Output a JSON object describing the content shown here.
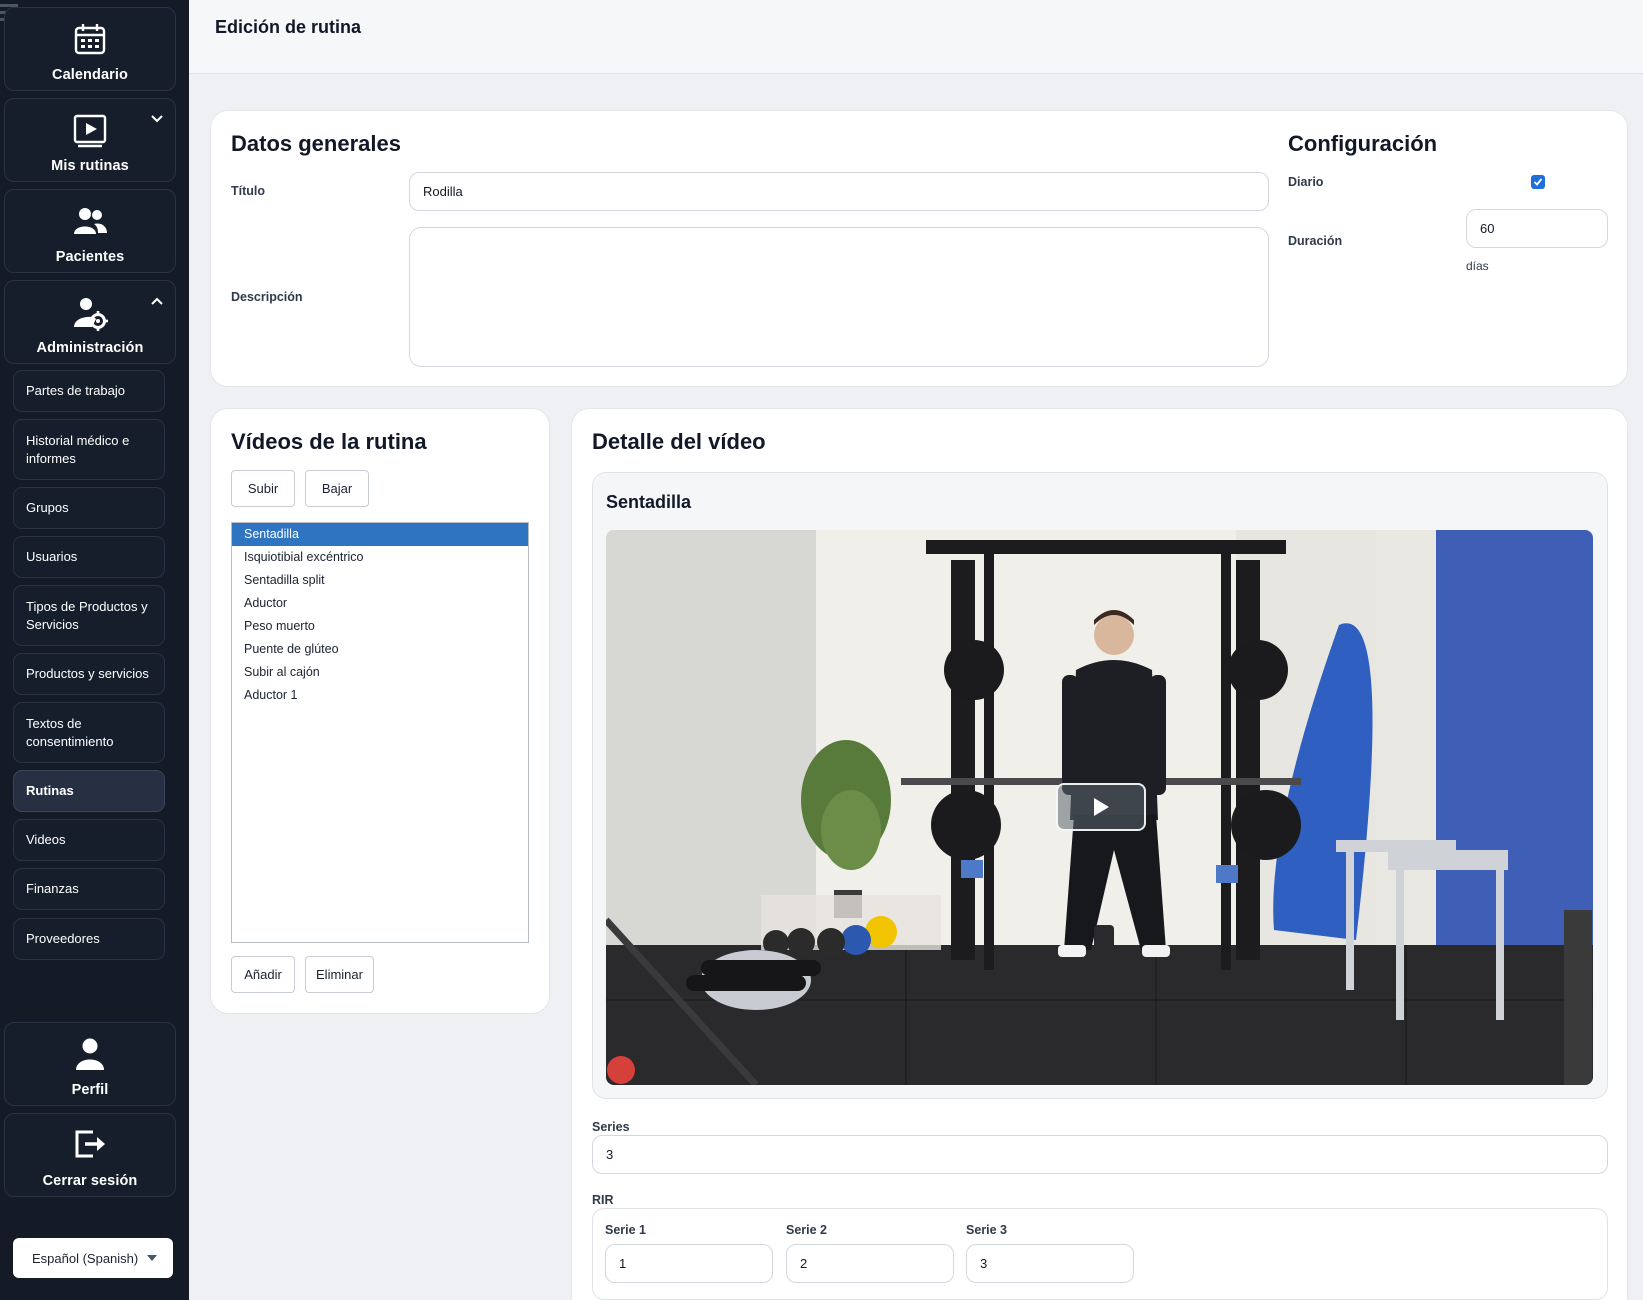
{
  "sidebar": {
    "calendar": "Calendario",
    "routines": "Mis rutinas",
    "patients": "Pacientes",
    "admin": "Administración",
    "admin_items": [
      "Partes de trabajo",
      "Historial médico e informes",
      "Grupos",
      "Usuarios",
      "Tipos de Productos y Servicios",
      "Productos y servicios",
      "Textos de consentimiento",
      "Rutinas",
      "Videos",
      "Finanzas",
      "Proveedores"
    ],
    "active_item": "Rutinas",
    "profile": "Perfil",
    "logout": "Cerrar sesión",
    "language": "Español (Spanish)"
  },
  "header": {
    "title": "Edición de rutina"
  },
  "general": {
    "heading": "Datos generales",
    "title_label": "Título",
    "title_value": "Rodilla",
    "description_label": "Descripción",
    "description_value": ""
  },
  "config": {
    "heading": "Configuración",
    "daily_label": "Diario",
    "daily_checked": true,
    "duration_label": "Duración",
    "duration_value": "60",
    "duration_unit": "días"
  },
  "videos": {
    "heading": "Vídeos de la rutina",
    "up_label": "Subir",
    "down_label": "Bajar",
    "items": [
      "Sentadilla",
      "Isquiotibial excéntrico",
      "Sentadilla split",
      "Aductor",
      "Peso muerto",
      "Puente de glúteo",
      "Subir al cajón",
      "Aductor 1"
    ],
    "selected": "Sentadilla",
    "add_label": "Añadir",
    "remove_label": "Eliminar"
  },
  "detail": {
    "heading": "Detalle del vídeo",
    "video_title": "Sentadilla",
    "series_label": "Series",
    "series_value": "3",
    "rir_label": "RIR",
    "rir": [
      {
        "label": "Serie 1",
        "value": "1"
      },
      {
        "label": "Serie 2",
        "value": "2"
      },
      {
        "label": "Serie 3",
        "value": "3"
      }
    ]
  },
  "colors": {
    "sidebar_bg": "#141b27",
    "accent": "#1e6fd9",
    "selected_row": "#2f74c0"
  }
}
